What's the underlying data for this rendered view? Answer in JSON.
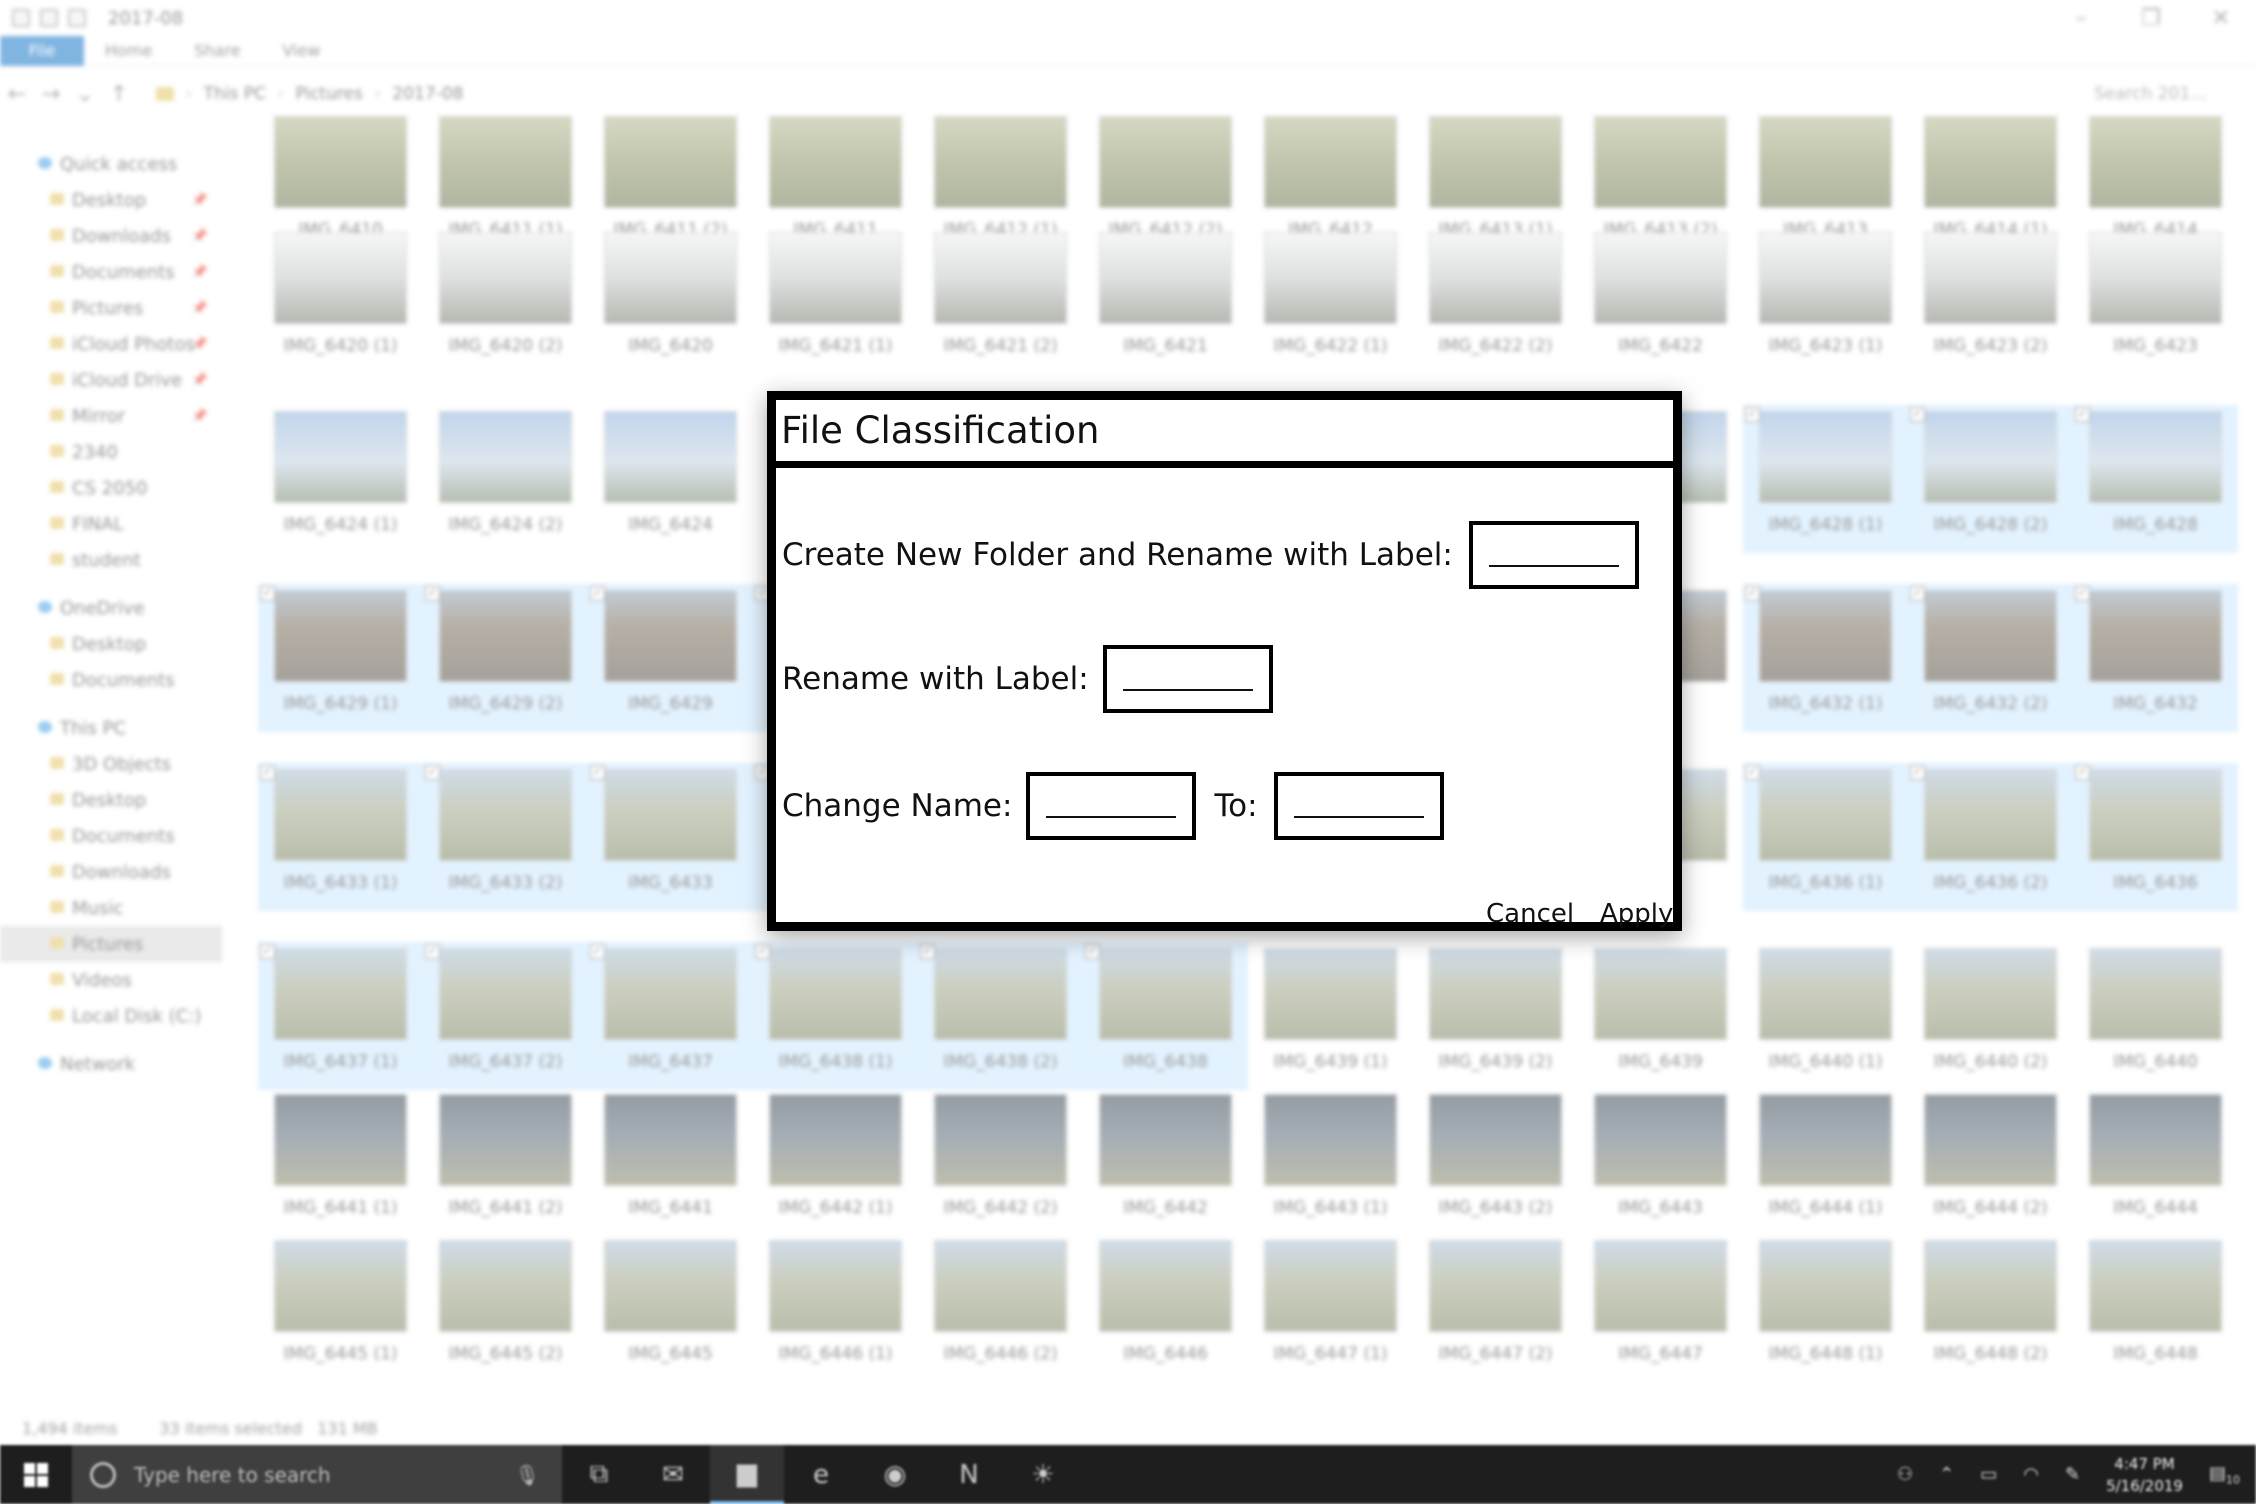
{
  "window": {
    "title": "2017-08",
    "ribbon_tabs": [
      "File",
      "Home",
      "Share",
      "View"
    ],
    "breadcrumbs": [
      "This PC",
      "Pictures",
      "2017-08"
    ],
    "search_placeholder": "Search 201..."
  },
  "sidebar": {
    "items": [
      {
        "label": "Quick access",
        "top": true,
        "pinned": false
      },
      {
        "label": "Desktop",
        "pinned": true
      },
      {
        "label": "Downloads",
        "pinned": true
      },
      {
        "label": "Documents",
        "pinned": true
      },
      {
        "label": "Pictures",
        "pinned": true
      },
      {
        "label": "iCloud Photos",
        "pinned": true
      },
      {
        "label": "iCloud Drive",
        "pinned": true
      },
      {
        "label": "Mirror",
        "pinned": true
      },
      {
        "label": "2340",
        "pinned": false
      },
      {
        "label": "CS 2050",
        "pinned": false
      },
      {
        "label": "FINAL",
        "pinned": false
      },
      {
        "label": "student",
        "pinned": false
      },
      {
        "label": "OneDrive",
        "top": true,
        "gap_before": true
      },
      {
        "label": "Desktop"
      },
      {
        "label": "Documents"
      },
      {
        "label": "This PC",
        "top": true,
        "gap_before": true
      },
      {
        "label": "3D Objects"
      },
      {
        "label": "Desktop"
      },
      {
        "label": "Documents"
      },
      {
        "label": "Downloads"
      },
      {
        "label": "Music"
      },
      {
        "label": "Pictures",
        "selected": true
      },
      {
        "label": "Videos"
      },
      {
        "label": "Local Disk (C:)"
      },
      {
        "label": "Network",
        "top": true,
        "gap_before": true
      }
    ]
  },
  "grid_rows": [
    {
      "thumb": "grass",
      "names": [
        "IMG_6410",
        "IMG_6411 (1)",
        "IMG_6411 (2)",
        "IMG_6411",
        "IMG_6412 (1)",
        "IMG_6412 (2)",
        "IMG_6412",
        "IMG_6413 (1)",
        "IMG_6413 (2)",
        "IMG_6413",
        "IMG_6414 (1)",
        "IMG_6414"
      ],
      "selected": []
    },
    {
      "thumb": "cloud",
      "names": [
        "IMG_6420 (1)",
        "IMG_6420 (2)",
        "IMG_6420",
        "IMG_6421 (1)",
        "IMG_6421 (2)",
        "IMG_6421",
        "IMG_6422 (1)",
        "IMG_6422 (2)",
        "IMG_6422",
        "IMG_6423 (1)",
        "IMG_6423 (2)",
        "IMG_6423"
      ],
      "selected": []
    },
    {
      "thumb": "blue",
      "names": [
        "IMG_6424 (1)",
        "IMG_6424 (2)",
        "IMG_6424",
        "",
        "",
        "",
        "",
        "",
        "",
        "IMG_6428 (1)",
        "IMG_6428 (2)",
        "IMG_6428"
      ],
      "selected": [
        9,
        10,
        11
      ]
    },
    {
      "thumb": "person",
      "names": [
        "IMG_6429 (1)",
        "IMG_6429 (2)",
        "IMG_6429",
        "",
        "",
        "",
        "",
        "",
        "",
        "IMG_6432 (1)",
        "IMG_6432 (2)",
        "IMG_6432"
      ],
      "selected": [
        0,
        1,
        2,
        3,
        9,
        10,
        11
      ]
    },
    {
      "thumb": "plain",
      "names": [
        "IMG_6433 (1)",
        "IMG_6433 (2)",
        "IMG_6433",
        "",
        "",
        "",
        "",
        "",
        "",
        "IMG_6436 (1)",
        "IMG_6436 (2)",
        "IMG_6436"
      ],
      "selected": [
        0,
        1,
        2,
        3,
        9,
        10,
        11
      ]
    },
    {
      "thumb": "plain",
      "names": [
        "IMG_6437 (1)",
        "IMG_6437 (2)",
        "IMG_6437",
        "IMG_6438 (1)",
        "IMG_6438 (2)",
        "IMG_6438",
        "IMG_6439 (1)",
        "IMG_6439 (2)",
        "IMG_6439",
        "IMG_6440 (1)",
        "IMG_6440 (2)",
        "IMG_6440"
      ],
      "selected": [
        0,
        1,
        2,
        3,
        4,
        5
      ]
    },
    {
      "thumb": "face",
      "names": [
        "IMG_6441 (1)",
        "IMG_6441 (2)",
        "IMG_6441",
        "IMG_6442 (1)",
        "IMG_6442 (2)",
        "IMG_6442",
        "IMG_6443 (1)",
        "IMG_6443 (2)",
        "IMG_6443",
        "IMG_6444 (1)",
        "IMG_6444 (2)",
        "IMG_6444"
      ],
      "selected": []
    },
    {
      "thumb": "plain",
      "names": [
        "IMG_6445 (1)",
        "IMG_6445 (2)",
        "IMG_6445",
        "IMG_6446 (1)",
        "IMG_6446 (2)",
        "IMG_6446",
        "IMG_6447 (1)",
        "IMG_6447 (2)",
        "IMG_6447",
        "IMG_6448 (1)",
        "IMG_6448 (2)",
        "IMG_6448"
      ],
      "selected": []
    }
  ],
  "status": {
    "item_count": "1,494 items",
    "selection": "33 items selected",
    "size": "131 MB"
  },
  "taskbar": {
    "search_placeholder": "Type here to search",
    "time": "4:47 PM",
    "date": "5/16/2019",
    "notification_count": "10"
  },
  "dialog": {
    "title": "File Classification",
    "row1_label": "Create New Folder and Rename with Label:",
    "row2_label": "Rename with Label:",
    "row3_label": "Change Name:",
    "row3_to": "To:",
    "cancel": "Cancel",
    "apply": "Apply"
  }
}
